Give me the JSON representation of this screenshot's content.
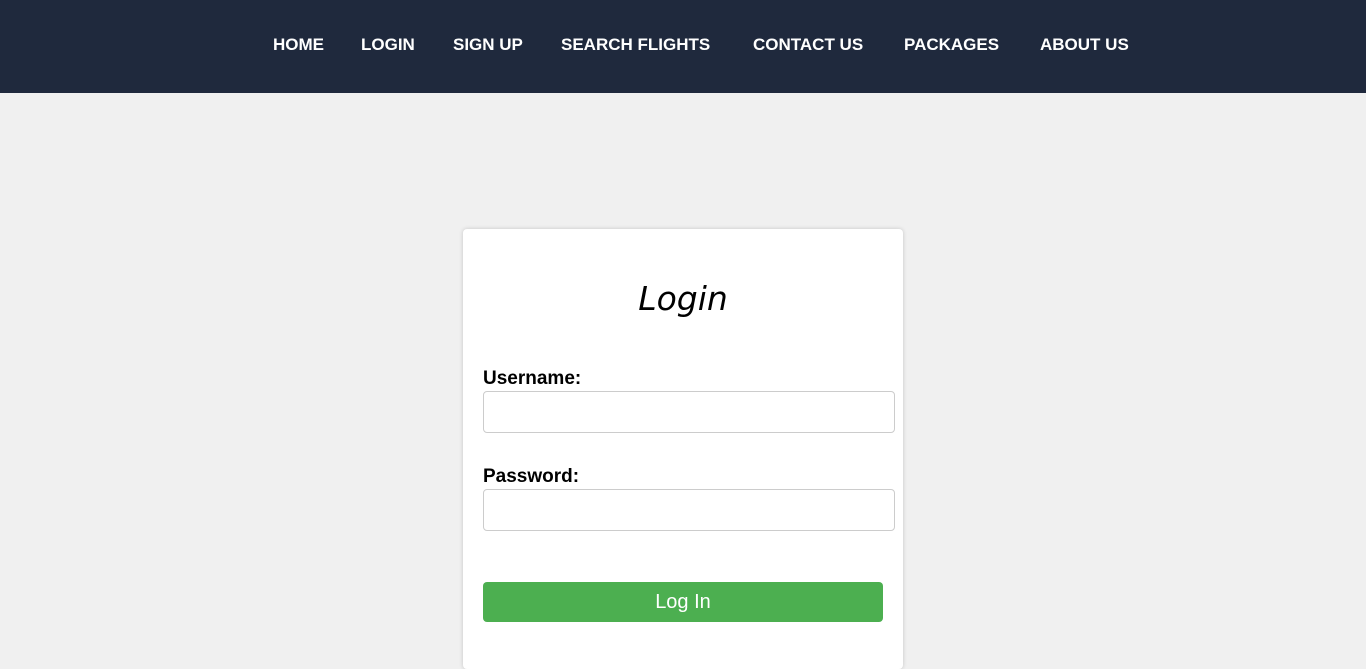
{
  "nav": {
    "items": [
      {
        "label": "HOME"
      },
      {
        "label": "LOGIN"
      },
      {
        "label": "SIGN UP"
      },
      {
        "label": "SEARCH FLIGHTS"
      },
      {
        "label": "CONTACT US"
      },
      {
        "label": "PACKAGES"
      },
      {
        "label": "ABOUT US"
      }
    ]
  },
  "login": {
    "title": "Login",
    "username_label": "Username:",
    "username_value": "",
    "password_label": "Password:",
    "password_value": "",
    "submit_label": "Log In"
  },
  "colors": {
    "navbar_bg": "#1f293d",
    "page_bg": "#f0f0f0",
    "button_bg": "#4caf50"
  }
}
